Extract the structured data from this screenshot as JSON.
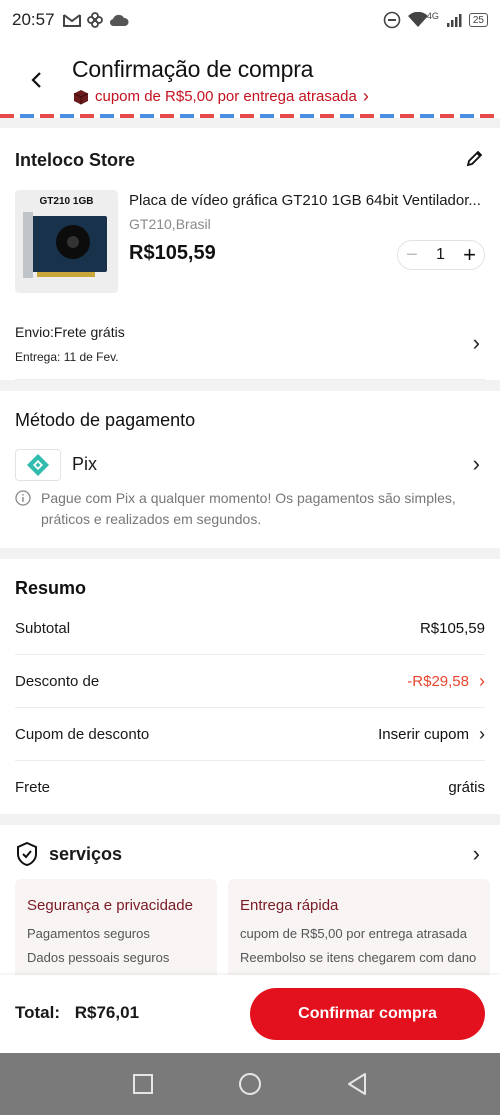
{
  "status_bar": {
    "time": "20:57",
    "network": "4G",
    "battery": "25"
  },
  "header": {
    "title": "Confirmação de compra",
    "coupon": "cupom de R$5,00 por entrega atrasada",
    "coupon_arrow": "›"
  },
  "store": {
    "name": "Inteloco Store",
    "product": {
      "image_label": "GT210 1GB",
      "title": "Placa de vídeo gráfica GT210 1GB 64bit Ventilador...",
      "variant": "GT210,Brasil",
      "price": "R$105,59",
      "quantity": "1",
      "minus": "−",
      "plus": "+"
    },
    "shipping": {
      "label": "Envio:Frete grátis",
      "delivery": "Entrega: 11 de Fev.",
      "arrow": "›"
    }
  },
  "payment": {
    "title": "Método de pagamento",
    "method": "Pix",
    "arrow": "›",
    "info": "Pague com Pix a qualquer momento! Os pagamentos são simples, práticos e realizados em segundos."
  },
  "summary": {
    "title": "Resumo",
    "rows": [
      {
        "label": "Subtotal",
        "value": "R$105,59"
      },
      {
        "label": "Desconto de",
        "value": "-R$29,58",
        "arrow": "›"
      },
      {
        "label": "Cupom de desconto",
        "value": "Inserir cupom",
        "arrow": "›"
      },
      {
        "label": "Frete",
        "value": "grátis"
      }
    ]
  },
  "services": {
    "title": "serviços",
    "arrow": "›",
    "cards": [
      {
        "title": "Segurança e privacidade",
        "lines": [
          "Pagamentos seguros",
          "Dados pessoais seguros"
        ]
      },
      {
        "title": "Entrega rápida",
        "lines": [
          "cupom de R$5,00 por entrega atrasada",
          "Reembolso se itens chegarem com dano"
        ]
      }
    ]
  },
  "footer": {
    "total_label": "Total:",
    "total_value": "R$76,01",
    "confirm": "Confirmar compra"
  },
  "colors": {
    "accent": "#e3111d",
    "discount": "#e8462f",
    "pix": "#32bcad"
  }
}
